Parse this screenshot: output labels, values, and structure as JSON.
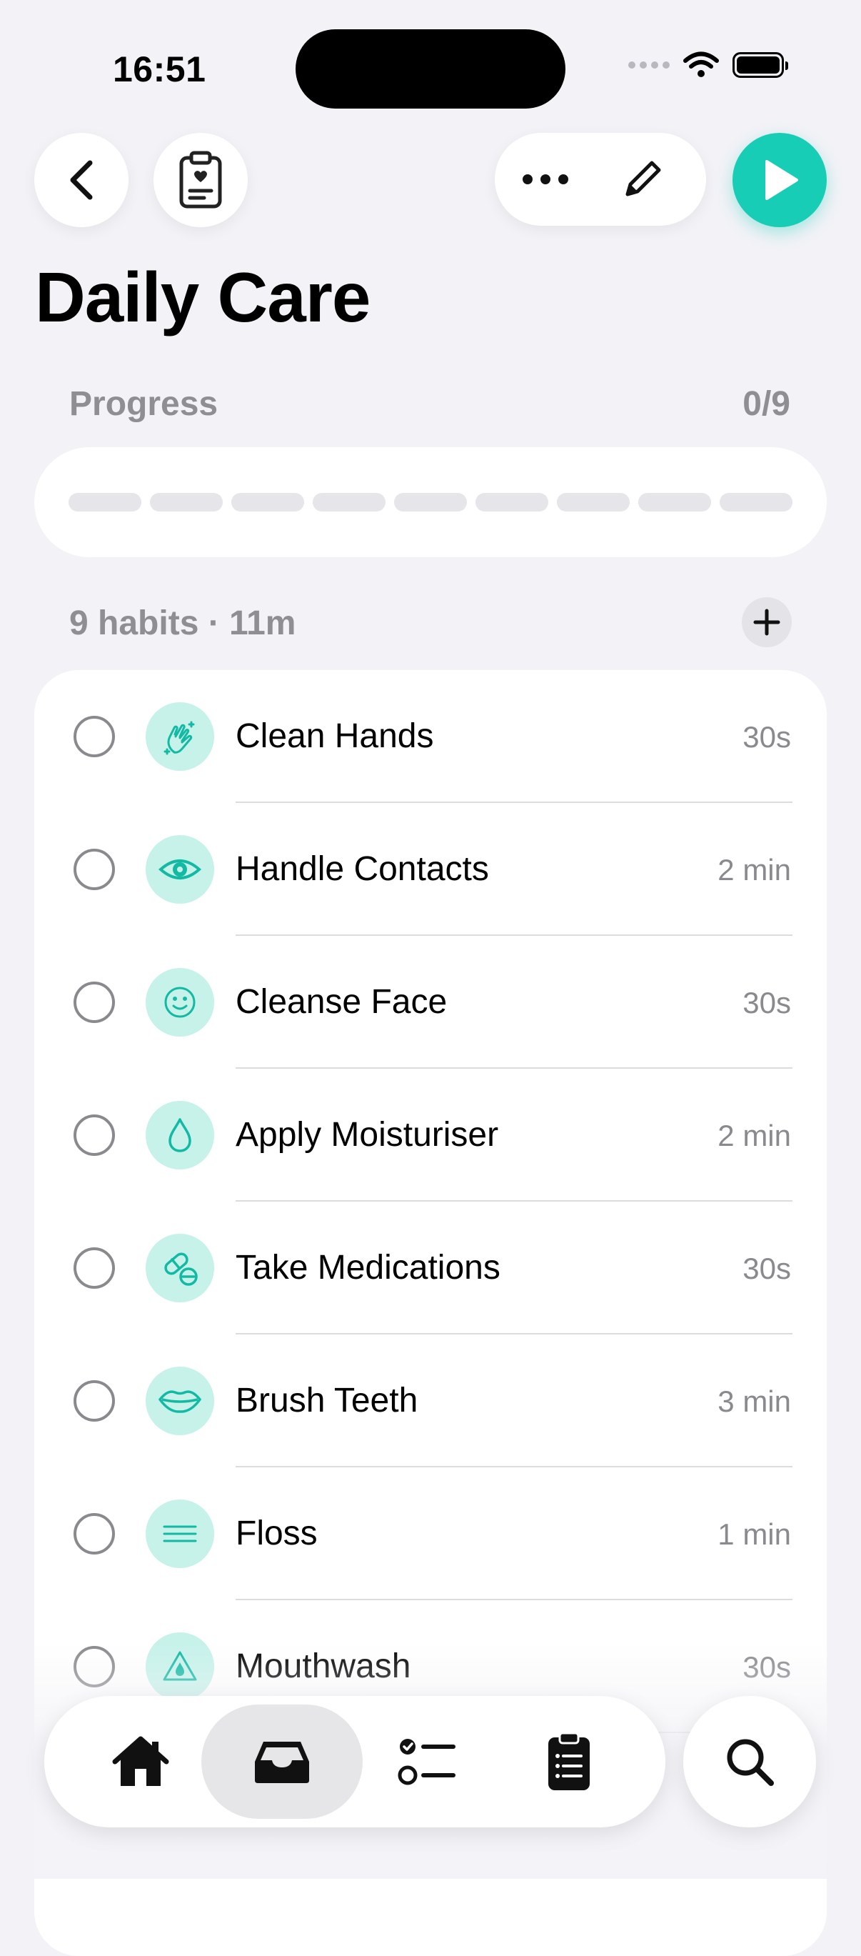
{
  "status_bar": {
    "time": "16:51"
  },
  "header": {
    "title": "Daily Care"
  },
  "progress": {
    "label": "Progress",
    "count": "0/9",
    "completed": 0,
    "total": 9
  },
  "habits_summary": "9 habits · 11m",
  "habits": [
    {
      "name": "Clean Hands",
      "duration": "30s",
      "icon": "clapping-hands-icon",
      "done": false
    },
    {
      "name": "Handle Contacts",
      "duration": "2 min",
      "icon": "eye-icon",
      "done": false
    },
    {
      "name": "Cleanse Face",
      "duration": "30s",
      "icon": "smiley-face-icon",
      "done": false
    },
    {
      "name": "Apply Moisturiser",
      "duration": "2 min",
      "icon": "drop-icon",
      "done": false
    },
    {
      "name": "Take Medications",
      "duration": "30s",
      "icon": "pills-icon",
      "done": false
    },
    {
      "name": "Brush Teeth",
      "duration": "3 min",
      "icon": "mouth-icon",
      "done": false
    },
    {
      "name": "Floss",
      "duration": "1 min",
      "icon": "lines-icon",
      "done": false
    },
    {
      "name": "Mouthwash",
      "duration": "30s",
      "icon": "drop-triangle-icon",
      "done": false
    }
  ],
  "tab_bar": {
    "tabs": [
      {
        "icon": "home-icon",
        "active": false
      },
      {
        "icon": "inbox-tray-icon",
        "active": true
      },
      {
        "icon": "checklist-icon",
        "active": false
      },
      {
        "icon": "clipboard-list-icon",
        "active": false
      }
    ],
    "search_icon": "magnifier-icon"
  },
  "colors": {
    "accent": "#17cdb5",
    "icon_bg": "#c6f2ea",
    "background": "#f2f2f7"
  }
}
